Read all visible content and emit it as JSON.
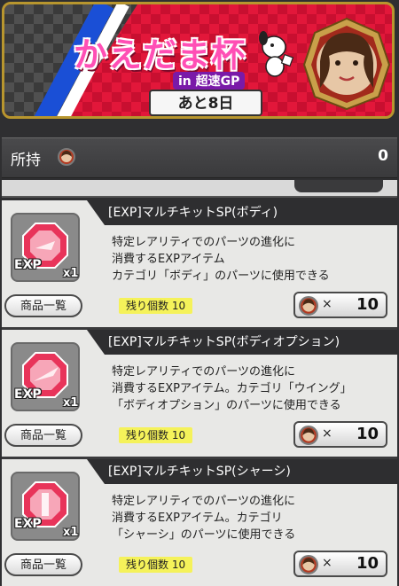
{
  "banner": {
    "title": "かえだま杯",
    "subtitle": "in 超速GP",
    "countdown": "あと8日"
  },
  "owned": {
    "label": "所持",
    "count": "0"
  },
  "items": [
    {
      "name": "[EXP]マルチキットSP(ボディ)",
      "exp": "EXP",
      "qty": "x1",
      "desc": [
        "特定レアリティでのパーツの進化に",
        "消費するEXPアイテム",
        "カテゴリ「ボディ」のパーツに使用できる"
      ],
      "list_label": "商品一覧",
      "remaining": "残り個数 10",
      "cost_mul": "×",
      "cost": "10",
      "color": "#e8345a"
    },
    {
      "name": "[EXP]マルチキットSP(ボディオプション)",
      "exp": "EXP",
      "qty": "x1",
      "desc": [
        "特定レアリティでのパーツの進化に",
        "消費するEXPアイテム。カテゴリ「ウイング」",
        "「ボディオプション」のパーツに使用できる"
      ],
      "list_label": "商品一覧",
      "remaining": "残り個数 10",
      "cost_mul": "×",
      "cost": "10",
      "color": "#e8345a"
    },
    {
      "name": "[EXP]マルチキットSP(シャーシ)",
      "exp": "EXP",
      "qty": "x1",
      "desc": [
        "特定レアリティでのパーツの進化に",
        "消費するEXPアイテム。カテゴリ",
        "「シャーシ」のパーツに使用できる"
      ],
      "list_label": "商品一覧",
      "remaining": "残り個数 10",
      "cost_mul": "×",
      "cost": "10",
      "color": "#e8345a"
    }
  ]
}
